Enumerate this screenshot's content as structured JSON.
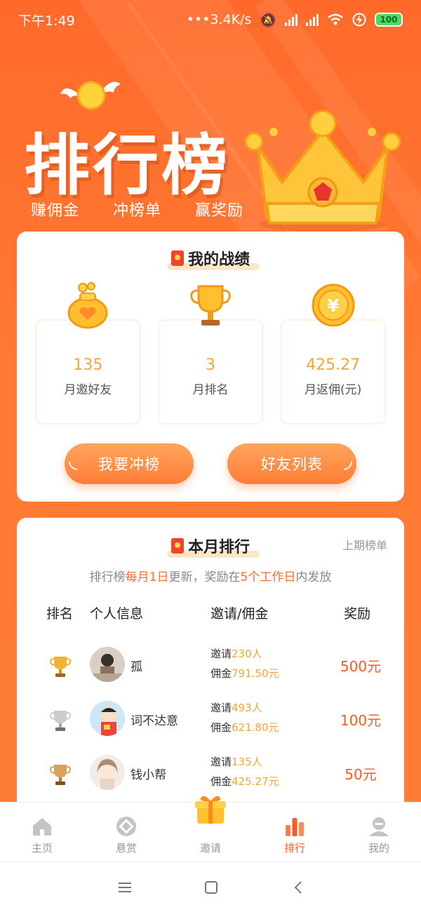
{
  "status_bar": {
    "time": "下午1:49",
    "network_speed": "•••3.4K/s",
    "battery": "100"
  },
  "hero": {
    "title": "排行榜",
    "subtitle_items": [
      "赚佣金",
      "冲榜单",
      "赢奖励"
    ]
  },
  "my_record": {
    "title": "我的战绩",
    "stats": [
      {
        "value": "135",
        "label": "月邀好友",
        "icon": "money-bag-icon"
      },
      {
        "value": "3",
        "label": "月排名",
        "icon": "trophy-icon"
      },
      {
        "value": "425.27",
        "label": "月返佣(元)",
        "icon": "yuan-coin-icon"
      }
    ],
    "btn_rank": "我要冲榜",
    "btn_friends": "好友列表"
  },
  "monthly": {
    "title": "本月排行",
    "last_period_link": "上期榜单",
    "notice_pre": "排行榜",
    "notice_hl1": "每月1日",
    "notice_mid": "更新，奖励在",
    "notice_hl2": "5个工作日",
    "notice_post": "内发放",
    "columns": [
      "排名",
      "个人信息",
      "邀请/佣金",
      "奖励"
    ],
    "rows": [
      {
        "name": "孤",
        "invite_prefix": "邀请",
        "invite_count": "230人",
        "commission_prefix": "佣金",
        "commission": "791.50元",
        "reward": "500元",
        "cup": "gold"
      },
      {
        "name": "词不达意",
        "invite_prefix": "邀请",
        "invite_count": "493人",
        "commission_prefix": "佣金",
        "commission": "621.80元",
        "reward": "100元",
        "cup": "silver"
      },
      {
        "name": "钱小帮",
        "invite_prefix": "邀请",
        "invite_count": "135人",
        "commission_prefix": "佣金",
        "commission": "425.27元",
        "reward": "50元",
        "cup": "bronze"
      }
    ]
  },
  "tabbar": {
    "items": [
      {
        "label": "主页",
        "icon": "home-icon"
      },
      {
        "label": "悬赏",
        "icon": "bounty-icon"
      },
      {
        "label": "邀请",
        "icon": "gift-icon"
      },
      {
        "label": "排行",
        "icon": "ranking-icon"
      },
      {
        "label": "我的",
        "icon": "profile-icon"
      }
    ],
    "active_index": 3
  },
  "colors": {
    "brand_orange": "#ff7330",
    "accent_gold": "#f0a63d",
    "reward_red": "#ff5a1f"
  }
}
